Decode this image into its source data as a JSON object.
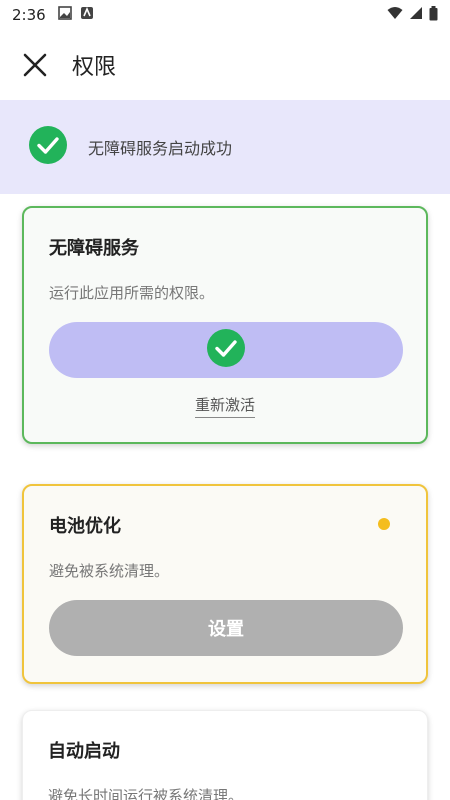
{
  "status_bar": {
    "time": "2:36",
    "icons_left": [
      "image-icon",
      "app-icon"
    ],
    "icons_right": [
      "wifi-icon",
      "signal-icon",
      "battery-icon"
    ]
  },
  "app_bar": {
    "title": "权限"
  },
  "banner": {
    "text": "无障碍服务启动成功",
    "icon": "check-circle-icon"
  },
  "cards": [
    {
      "title": "无障碍服务",
      "description": "运行此应用所需的权限。",
      "action_icon": "check-circle-icon",
      "secondary_link": "重新激活",
      "border_color": "#5cb85c"
    },
    {
      "title": "电池优化",
      "description": "避免被系统清理。",
      "button_label": "设置",
      "indicator_color": "#f4bd1e",
      "border_color": "#f0c43c"
    },
    {
      "title": "自动启动",
      "description": "避免长时间运行被系统清理。"
    }
  ],
  "colors": {
    "success_green": "#22b35a",
    "banner_bg": "#e8e7fb",
    "active_pill": "#bfbdf4",
    "disabled_pill": "#b0b0b0"
  }
}
